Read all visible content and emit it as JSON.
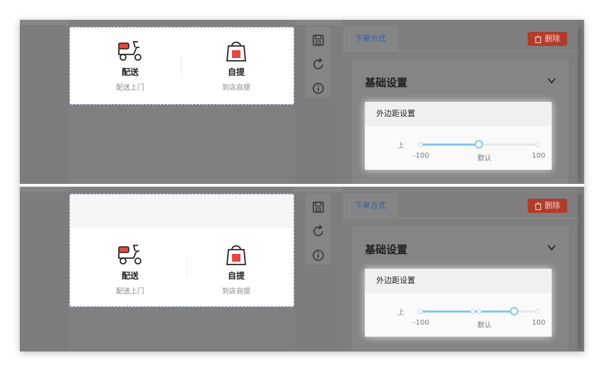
{
  "panels": [
    {
      "id": "before",
      "options": [
        {
          "title": "配送",
          "subtitle": "配送上门",
          "icon": "scooter-icon"
        },
        {
          "title": "自提",
          "subtitle": "到店自提",
          "icon": "shopping-bag-icon"
        }
      ],
      "slider": {
        "min": -100,
        "max": 100,
        "value": 0,
        "stops": [
          -100,
          0,
          100
        ]
      }
    },
    {
      "id": "after",
      "options": [
        {
          "title": "配送",
          "subtitle": "配送上门",
          "icon": "scooter-icon"
        },
        {
          "title": "自提",
          "subtitle": "到店自提",
          "icon": "shopping-bag-icon"
        }
      ],
      "slider": {
        "min": -100,
        "max": 100,
        "value": 60,
        "stops": [
          -100,
          -10,
          0,
          60,
          100
        ]
      }
    }
  ],
  "toolbar": {
    "icons": [
      "save-icon",
      "refresh-icon",
      "info-icon"
    ]
  },
  "settings": {
    "tab_label": "下单方式",
    "delete_label": "删除",
    "section_title": "基础设置",
    "margin_title": "外边距设置",
    "row_label": "上",
    "tick_min": "-100",
    "tick_mid": "默认",
    "tick_max": "100"
  },
  "colors": {
    "accent": "#84c7ef",
    "danger": "#b03c2c",
    "tab_text": "#2b5ea8",
    "scooter_red": "#e8453c"
  }
}
